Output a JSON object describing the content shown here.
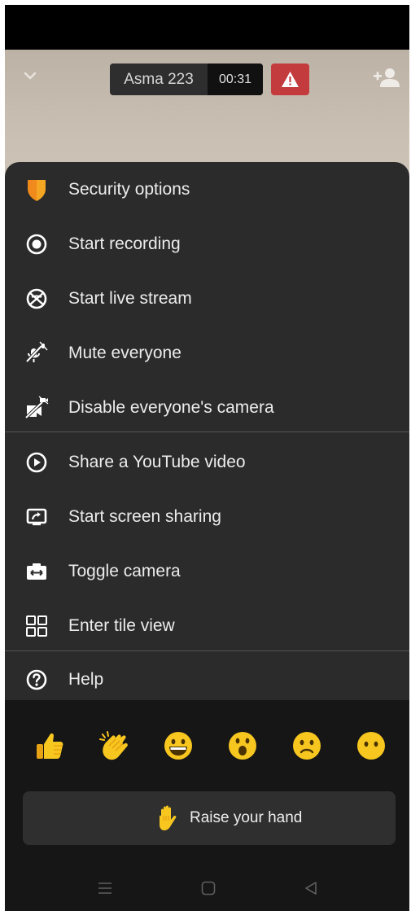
{
  "call": {
    "participant_name": "Asma 223",
    "timer": "00:31"
  },
  "menu": {
    "items": [
      {
        "label": "Security options",
        "icon": "shield-icon"
      },
      {
        "label": "Start recording",
        "icon": "record-icon"
      },
      {
        "label": "Start live stream",
        "icon": "live-stream-icon"
      },
      {
        "label": "Mute everyone",
        "icon": "mute-everyone-icon"
      },
      {
        "label": "Disable everyone's camera",
        "icon": "camera-off-icon"
      },
      {
        "label": "Share a YouTube video",
        "icon": "play-icon"
      },
      {
        "label": "Start screen sharing",
        "icon": "screen-share-icon"
      },
      {
        "label": "Toggle camera",
        "icon": "camera-switch-icon"
      },
      {
        "label": "Enter tile view",
        "icon": "tile-view-icon"
      },
      {
        "label": "Help",
        "icon": "help-icon"
      }
    ]
  },
  "reactions": {
    "items": [
      "thumbs-up-icon",
      "clap-icon",
      "grin-icon",
      "surprised-icon",
      "sad-icon",
      "neutral-face-icon"
    ],
    "raise_hand_label": "Raise your hand"
  },
  "colors": {
    "sheet": "#2b2b2b",
    "warning": "#c43b3d",
    "shield": "#f5a623",
    "emoji": "#f7c71f"
  }
}
